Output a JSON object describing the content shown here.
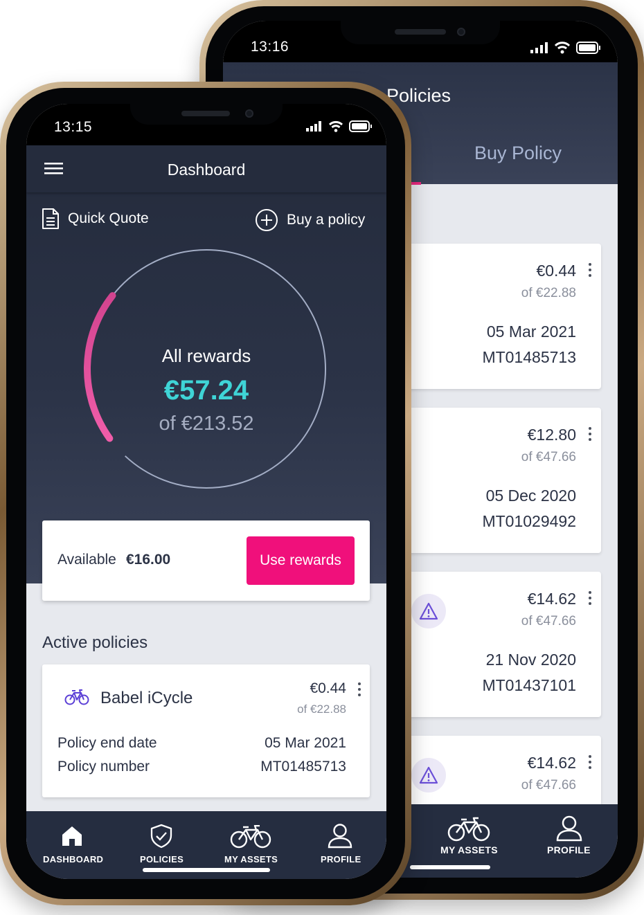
{
  "back_phone": {
    "status_time": "13:16",
    "header_title": "Policies",
    "tab_buy": "Buy Policy",
    "cards": [
      {
        "amount": "€0.44",
        "of": "of €22.88",
        "date": "05 Mar 2021",
        "number": "MT01485713",
        "warning": false
      },
      {
        "amount": "€12.80",
        "of": "of €47.66",
        "date": "05 Dec 2020",
        "number": "MT01029492",
        "warning": false
      },
      {
        "amount": "€14.62",
        "of": "of €47.66",
        "date": "21 Nov 2020",
        "number": "MT01437101",
        "warning": true
      },
      {
        "amount": "€14.62",
        "of": "of €47.66",
        "warning": true
      }
    ],
    "nav": {
      "assets": "MY ASSETS",
      "profile": "PROFILE"
    }
  },
  "front_phone": {
    "status_time": "13:15",
    "title": "Dashboard",
    "quick_quote": "Quick Quote",
    "buy_policy": "Buy a policy",
    "gauge": {
      "label": "All rewards",
      "value": "€57.24",
      "total": "of €213.52",
      "fraction": 0.268
    },
    "available_label": "Available",
    "available_value": "€16.00",
    "use_rewards": "Use rewards",
    "active_policies": "Active policies",
    "policy": {
      "name": "Babel iCycle",
      "amount": "€0.44",
      "of": "of €22.88",
      "end_date_label": "Policy end date",
      "end_date": "05 Mar 2021",
      "number_label": "Policy number",
      "number": "MT01485713"
    },
    "nav": {
      "dashboard": "DASHBOARD",
      "policies": "POLICIES",
      "assets": "MY ASSETS",
      "profile": "PROFILE"
    }
  },
  "colors": {
    "accent": "#f0107b",
    "teal": "#3fd4d6",
    "navy": "#252d40",
    "icon_purple": "#5b3fd6"
  }
}
